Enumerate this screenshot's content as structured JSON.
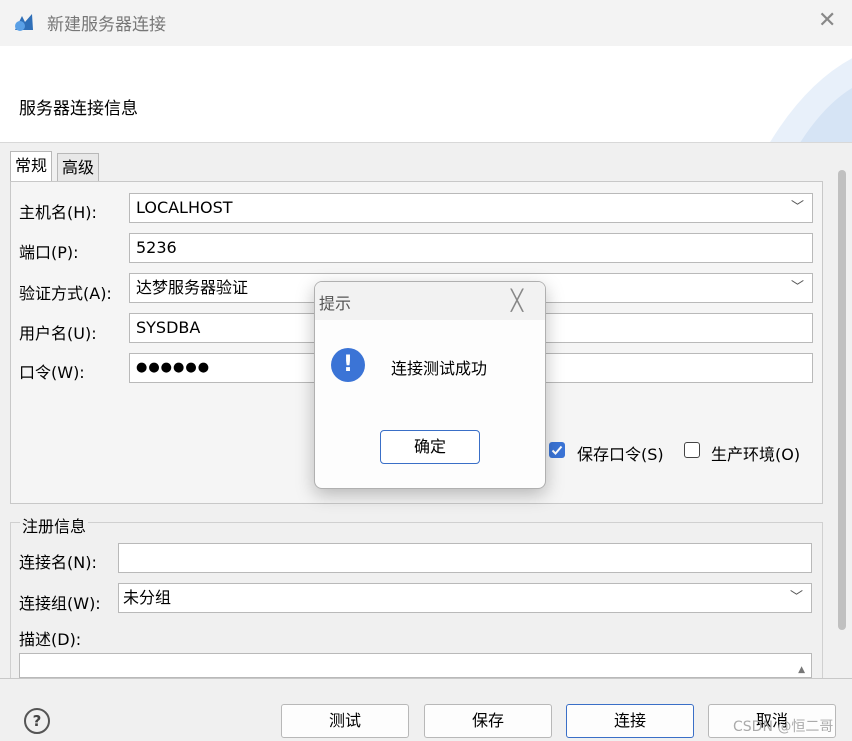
{
  "window": {
    "title": "新建服务器连接",
    "close_glyph": "✕"
  },
  "header": {
    "title": "服务器连接信息"
  },
  "tabs": [
    {
      "label": "常规"
    },
    {
      "label": "高级"
    }
  ],
  "form": {
    "host": {
      "label": "主机名(H):",
      "value": "LOCALHOST"
    },
    "port": {
      "label": "端口(P):",
      "value": "5236"
    },
    "auth": {
      "label": "验证方式(A):",
      "value": "达梦服务器验证"
    },
    "user": {
      "label": "用户名(U):",
      "value": "SYSDBA"
    },
    "password": {
      "label": "口令(W):",
      "value": "●●●●●●"
    },
    "save_password": {
      "label": "保存口令(S)",
      "checked": true
    },
    "production": {
      "label": "生产环境(O)",
      "checked": false
    }
  },
  "registration": {
    "title": "注册信息",
    "conn_name": {
      "label": "连接名(N):",
      "value": ""
    },
    "conn_group": {
      "label": "连接组(W):",
      "value": "未分组"
    },
    "description": {
      "label": "描述(D):",
      "value": ""
    }
  },
  "buttons": {
    "help": "?",
    "test": "测试",
    "save": "保存",
    "connect": "连接",
    "cancel": "取消"
  },
  "dialog": {
    "title": "提示",
    "close_glyph": "╳",
    "icon": "!",
    "message": "连接测试成功",
    "ok": "确定"
  },
  "watermark": "CSDN @恒二哥",
  "icons": {
    "dropdown": "chevron-down-icon",
    "info": "info-icon"
  },
  "colors": {
    "accent": "#3a6fc7",
    "checkbox": "#3b74d6"
  }
}
